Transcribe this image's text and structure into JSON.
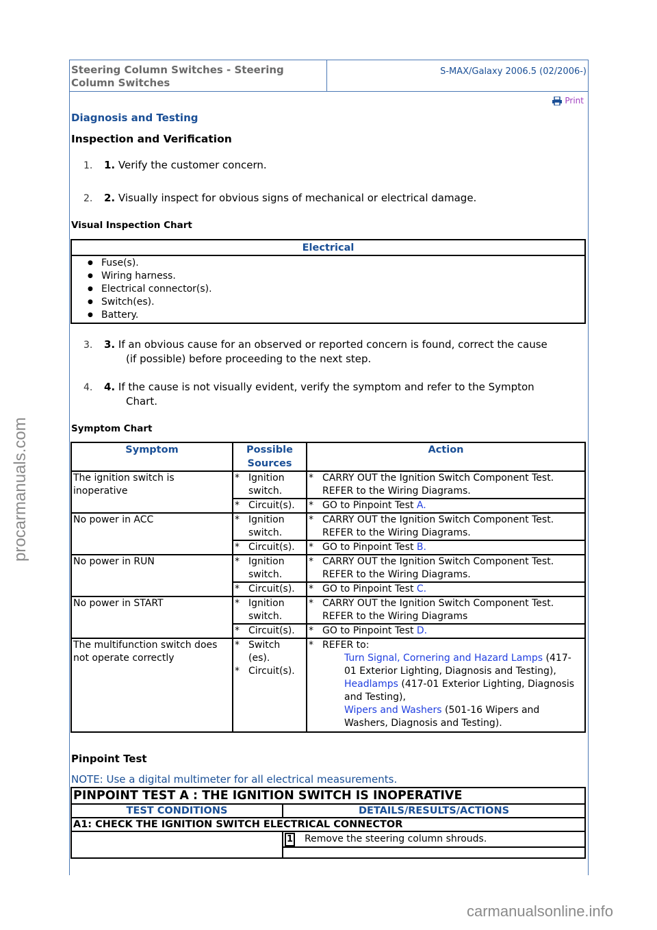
{
  "header": {
    "title": "Steering Column Switches - Steering Column Switches",
    "model": "S-MAX/Galaxy 2006.5 (02/2006-)",
    "print_label": "Print",
    "print_icon": "printer-icon"
  },
  "section": {
    "diagnosis": "Diagnosis and Testing",
    "inspection": "Inspection and Verification"
  },
  "steps": [
    {
      "num": "1.",
      "bold": "1.",
      "text": "Verify the customer concern."
    },
    {
      "num": "2.",
      "bold": "2.",
      "text": "Visually inspect for obvious signs of mechanical or electrical damage."
    },
    {
      "num": "3.",
      "bold": "3.",
      "text": "If an obvious cause for an observed or reported concern is found, correct the cause",
      "cont": "(if possible) before proceeding to the next step."
    },
    {
      "num": "4.",
      "bold": "4.",
      "text": "If the cause is not visually evident, verify the symptom and refer to the Sympton",
      "cont": "Chart."
    }
  ],
  "visual_chart": {
    "title": "Visual Inspection Chart",
    "header": "Electrical",
    "items": [
      "Fuse(s).",
      "Wiring harness.",
      "Electrical connector(s).",
      "Switch(es).",
      "Battery."
    ]
  },
  "symptom_chart": {
    "title": "Symptom Chart",
    "columns": [
      "Symptom",
      "Possible Sources",
      "Action"
    ],
    "rows": [
      {
        "symptom": "The ignition switch is inoperative",
        "entries": [
          {
            "source": "Ignition switch.",
            "action": "CARRY OUT the Ignition Switch Component Test. REFER to the Wiring Diagrams."
          },
          {
            "source": "Circuit(s).",
            "action": "GO to Pinpoint Test ",
            "link": "A."
          }
        ]
      },
      {
        "symptom": "No power in ACC",
        "entries": [
          {
            "source": "Ignition switch.",
            "action": "CARRY OUT the Ignition Switch Component Test. REFER to the Wiring Diagrams."
          },
          {
            "source": "Circuit(s).",
            "action": "GO to Pinpoint Test ",
            "link": "B."
          }
        ]
      },
      {
        "symptom": "No power in RUN",
        "entries": [
          {
            "source": "Ignition switch.",
            "action": "CARRY OUT the Ignition Switch Component Test. REFER to the Wiring Diagrams."
          },
          {
            "source": "Circuit(s).",
            "action": "GO to Pinpoint Test ",
            "link": "C."
          }
        ]
      },
      {
        "symptom": "No power in START",
        "entries": [
          {
            "source": "Ignition switch.",
            "action": "CARRY OUT the Ignition Switch Component Test. REFER to the Wiring Diagrams"
          },
          {
            "source": "Circuit(s).",
            "action": "GO to Pinpoint Test ",
            "link": "D."
          }
        ]
      }
    ],
    "multifunction": {
      "symptom": "The multifunction switch does not operate correctly",
      "sources": [
        "Switch (es).",
        "Circuit(s)."
      ],
      "refer_label": "REFER to:",
      "refs": [
        {
          "link": "Turn Signal, Cornering and Hazard Lamps",
          "text": " (417-01 Exterior Lighting, Diagnosis and Testing),"
        },
        {
          "link": "Headlamps",
          "text": " (417-01 Exterior Lighting, Diagnosis and Testing),"
        },
        {
          "link": "Wipers and Washers",
          "text": " (501-16 Wipers and Washers, Diagnosis and Testing)."
        }
      ]
    }
  },
  "pinpoint": {
    "title": "Pinpoint Test",
    "note": "NOTE: Use a digital multimeter for all electrical measurements.",
    "test_title": "PINPOINT TEST A : THE IGNITION SWITCH IS INOPERATIVE",
    "col_conditions": "TEST CONDITIONS",
    "col_details": "DETAILS/RESULTS/ACTIONS",
    "step_title": "A1: CHECK THE IGNITION SWITCH ELECTRICAL CONNECTOR",
    "substeps": [
      {
        "num": "1",
        "text": "Remove the steering column shrouds."
      }
    ]
  },
  "watermarks": {
    "left": "procarmanuals.com",
    "bottom": "carmanualsonline.info"
  },
  "colors": {
    "heading_blue": "#1a4f96",
    "link_blue": "#1f3ee0",
    "frame_blue": "#4a78b5",
    "print_purple": "#a040c0"
  }
}
